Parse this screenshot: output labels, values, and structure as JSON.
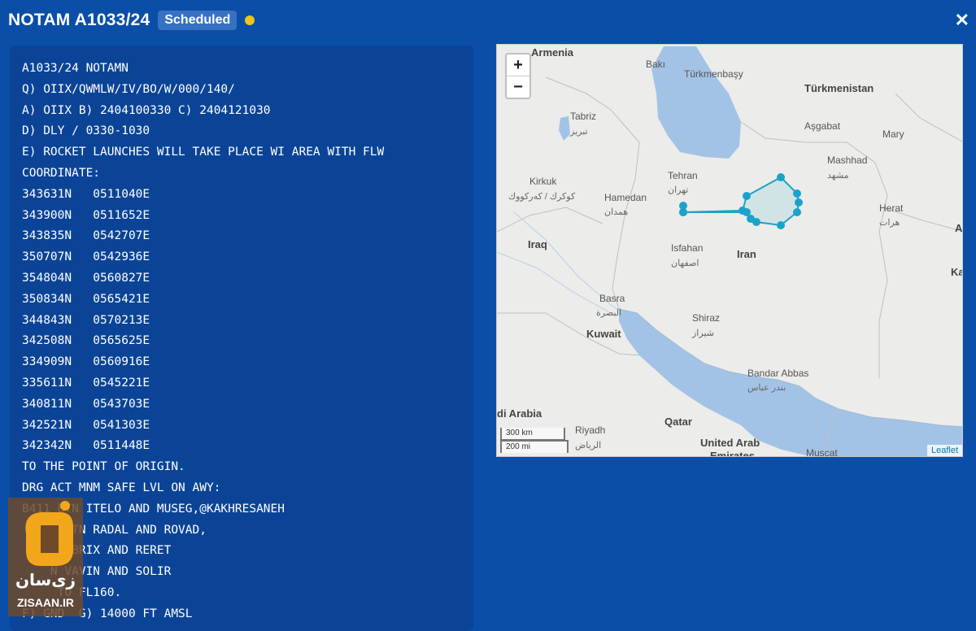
{
  "header": {
    "title": "NOTAM A1033/24",
    "status": "Scheduled",
    "status_color": "#f0c419",
    "close_icon": "✕"
  },
  "notam": {
    "lines": [
      "A1033/24 NOTAMN",
      "Q) OIIX/QWMLW/IV/BO/W/000/140/",
      "A) OIIX B) 2404100330 C) 2404121030",
      "D) DLY / 0330-1030",
      "E) ROCKET LAUNCHES WILL TAKE PLACE WI AREA WITH FLW",
      "COORDINATE:",
      "343631N   0511040E",
      "343900N   0511652E",
      "343835N   0542707E",
      "350707N   0542936E",
      "354804N   0560827E",
      "350834N   0565421E",
      "344843N   0570213E",
      "342508N   0565625E",
      "334909N   0560916E",
      "335611N   0545221E",
      "340811N   0543703E",
      "342521N   0541303E",
      "342342N   0511448E",
      "TO THE POINT OF ORIGIN.",
      "DRG ACT MNM SAFE LVL ON AWY:",
      "B411 BTN ITELO AND MUSEG,@KAKHRESANEH",
      "  125 BTN RADAL AND ROVAD,",
      "    N OBRIX AND RERET",
      "    N VAVIN AND SOLIR",
      "     TO FL160.",
      "F) GND  G) 14000 FT AMSL"
    ]
  },
  "map": {
    "zoom_in": "+",
    "zoom_out": "−",
    "scale_km": "300 km",
    "scale_mi": "200 mi",
    "attribution": "Leaflet",
    "water_color": "#a3c3e6",
    "polygon_color": "#1aa3c9",
    "labels": [
      {
        "text": "Armenia",
        "kind": "country"
      },
      {
        "text": "Bakı",
        "kind": "city"
      },
      {
        "text": "Türkmenbaşy",
        "kind": "city"
      },
      {
        "text": "Türkmenistan",
        "kind": "country"
      },
      {
        "text": "Tabriz",
        "kind": "city"
      },
      {
        "text": "تبریز",
        "kind": "native"
      },
      {
        "text": "Aşgabat",
        "kind": "city"
      },
      {
        "text": "Mary",
        "kind": "city"
      },
      {
        "text": "Mashhad",
        "kind": "city"
      },
      {
        "text": "مشهد",
        "kind": "native"
      },
      {
        "text": "Tehran",
        "kind": "city"
      },
      {
        "text": "تهران",
        "kind": "native"
      },
      {
        "text": "Kirkuk",
        "kind": "city"
      },
      {
        "text": "كوكرك / كەركووك",
        "kind": "native"
      },
      {
        "text": "Hamedan",
        "kind": "city"
      },
      {
        "text": "همدان",
        "kind": "native"
      },
      {
        "text": "Herat",
        "kind": "city"
      },
      {
        "text": "هرات",
        "kind": "native"
      },
      {
        "text": "Iraq",
        "kind": "country"
      },
      {
        "text": "Isfahan",
        "kind": "city"
      },
      {
        "text": "اصفهان",
        "kind": "native"
      },
      {
        "text": "Iran",
        "kind": "country"
      },
      {
        "text": "Afg",
        "kind": "country"
      },
      {
        "text": "Kar",
        "kind": "country"
      },
      {
        "text": "Basra",
        "kind": "city"
      },
      {
        "text": "البصرة",
        "kind": "native"
      },
      {
        "text": "Kuwait",
        "kind": "country"
      },
      {
        "text": "Shiraz",
        "kind": "city"
      },
      {
        "text": "شيراز",
        "kind": "native"
      },
      {
        "text": "Bandar Abbas",
        "kind": "city"
      },
      {
        "text": "بندر عباس",
        "kind": "native"
      },
      {
        "text": "di Arabia",
        "kind": "country"
      },
      {
        "text": "Riyadh",
        "kind": "city"
      },
      {
        "text": "الرياض",
        "kind": "native"
      },
      {
        "text": "Qatar",
        "kind": "country"
      },
      {
        "text": "United Arab",
        "kind": "country"
      },
      {
        "text": "Emirates",
        "kind": "country"
      },
      {
        "text": "Muscat",
        "kind": "city"
      }
    ]
  },
  "watermark": {
    "logo_text": "زی‌سان",
    "site": "ZISAAN.IR"
  }
}
